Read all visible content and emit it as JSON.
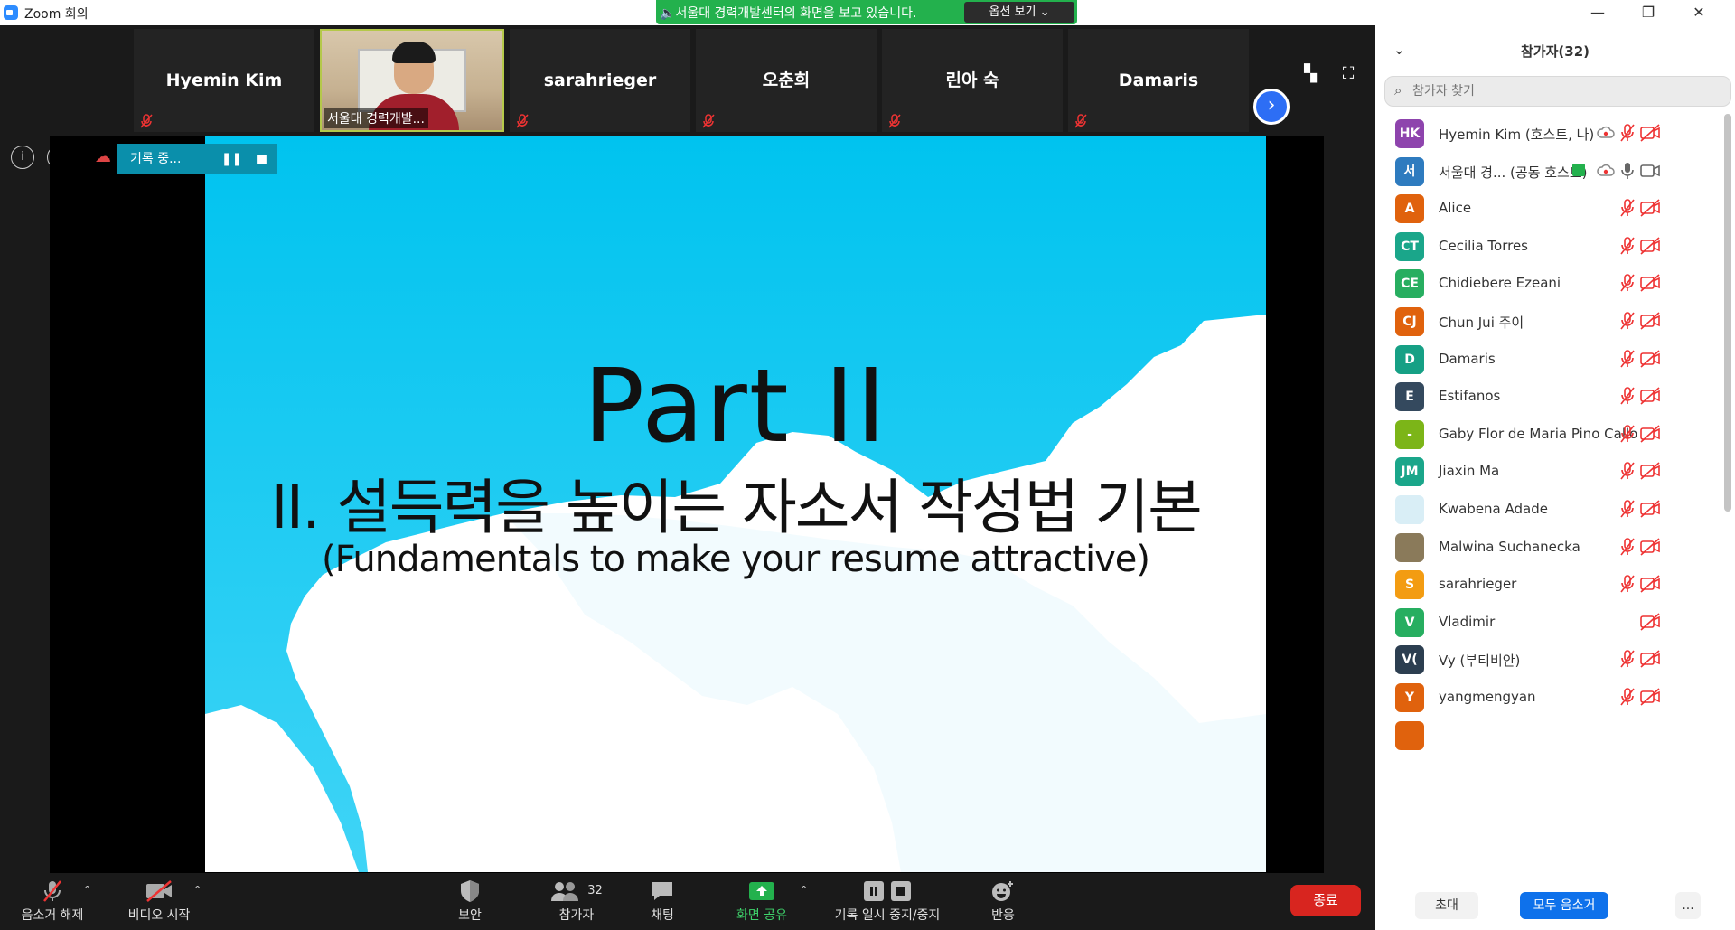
{
  "window": {
    "title": "Zoom 회의",
    "minimize": "—",
    "restore": "❐",
    "close": "✕"
  },
  "share_banner": {
    "message": "서울대 경력개발센터의 화면을 보고 있습니다.",
    "options": "옵션 보기 ⌄"
  },
  "gallery": {
    "tiles": [
      {
        "name": "Hyemin Kim"
      },
      {
        "name": "서울대 경력개발..."
      },
      {
        "name": "sarahrieger"
      },
      {
        "name": "오춘희"
      },
      {
        "name": "린아 숙"
      },
      {
        "name": "Damaris"
      }
    ],
    "next": "›"
  },
  "recording": {
    "label": "기록 중...",
    "pause": "❚❚",
    "stop": "■"
  },
  "slide": {
    "title": "Part II",
    "subtitle": "II. 설득력을 높이는 자소서 작성법 기본",
    "english": "(Fundamentals to make your resume attractive)"
  },
  "toolbar": {
    "unmute": "음소거 해제",
    "start_video": "비디오 시작",
    "security": "보안",
    "participants": "참가자",
    "participants_count": "32",
    "chat": "채팅",
    "share_screen": "화면 공유",
    "pause_recording": "기록 일시 중지/중지",
    "reactions": "반응",
    "end": "종료",
    "colors": {
      "share": "#23b14d",
      "end": "#d8251f"
    }
  },
  "participants_panel": {
    "title": "참가자(32)",
    "search_placeholder": "참가자 찾기",
    "people": [
      {
        "initials": "HK",
        "name": "Hyemin Kim (호스트, 나)",
        "color": "#8e44ad"
      },
      {
        "initials": "서",
        "name": "서울대 경... (공동 호스트)",
        "color": "#2e7bbf"
      },
      {
        "initials": "A",
        "name": "Alice",
        "color": "#e0620d"
      },
      {
        "initials": "CT",
        "name": "Cecilia Torres",
        "color": "#1aa68a"
      },
      {
        "initials": "CE",
        "name": "Chidiebere Ezeani",
        "color": "#27ae60"
      },
      {
        "initials": "CJ",
        "name": "Chun Jui 주이",
        "color": "#e0620d"
      },
      {
        "initials": "D",
        "name": "Damaris",
        "color": "#16a085"
      },
      {
        "initials": "E",
        "name": "Estifanos",
        "color": "#34495e"
      },
      {
        "initials": "-",
        "name": "Gaby Flor de Maria Pino Callo",
        "color": "#7cb518"
      },
      {
        "initials": "JM",
        "name": "Jiaxin Ma",
        "color": "#1aa68a"
      },
      {
        "initials": "",
        "name": "Kwabena Adade",
        "color": "#d9eef6"
      },
      {
        "initials": "",
        "name": "Malwina Suchanecka",
        "color": "#8a7a5a"
      },
      {
        "initials": "S",
        "name": "sarahrieger",
        "color": "#f39c12"
      },
      {
        "initials": "V",
        "name": "Vladimir",
        "color": "#27ae60"
      },
      {
        "initials": "V(",
        "name": "Vy (부티비안)",
        "color": "#2c3e50"
      },
      {
        "initials": "Y",
        "name": "yangmengyan",
        "color": "#e0620d"
      },
      {
        "initials": "",
        "name": "",
        "color": "#e0620d"
      }
    ],
    "invite": "초대",
    "mute_all": "모두 음소거",
    "more": "..."
  }
}
